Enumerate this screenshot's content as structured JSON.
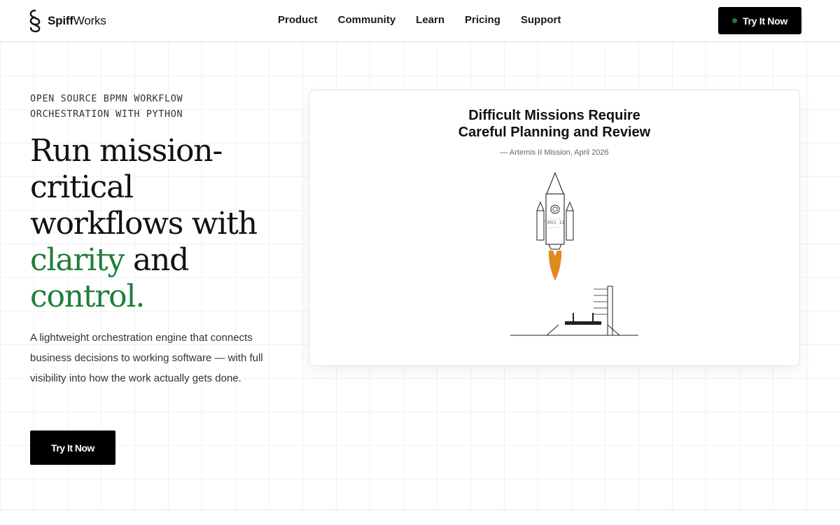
{
  "brand": {
    "name_bold": "Spiff",
    "name_regular": "Works"
  },
  "nav": {
    "items": [
      {
        "label": "Product"
      },
      {
        "label": "Community"
      },
      {
        "label": "Learn"
      },
      {
        "label": "Pricing"
      },
      {
        "label": "Support"
      }
    ],
    "cta_label": "Try It Now"
  },
  "hero": {
    "eyebrow_line1": "OPEN SOURCE BPMN WORKFLOW",
    "eyebrow_line2": "ORCHESTRATION WITH PYTHON",
    "headline_part1": "Run mission-critical workflows with",
    "headline_green1": "clarity",
    "headline_part2": "and",
    "headline_green2": "control.",
    "description": "A lightweight orchestration engine that connects business decisions to working software — with full visibility into how the work actually gets done.",
    "cta_label": "Try It Now"
  },
  "card": {
    "title_line1": "Difficult Missions Require",
    "title_line2": "Careful Planning and Review",
    "caption": "— Artemis II Mission, April 2026",
    "rocket_label": "ARTEMIS II"
  },
  "colors": {
    "accent_green": "#1e7e3a",
    "flame_orange": "#e08a1e",
    "button_black": "#000000"
  }
}
